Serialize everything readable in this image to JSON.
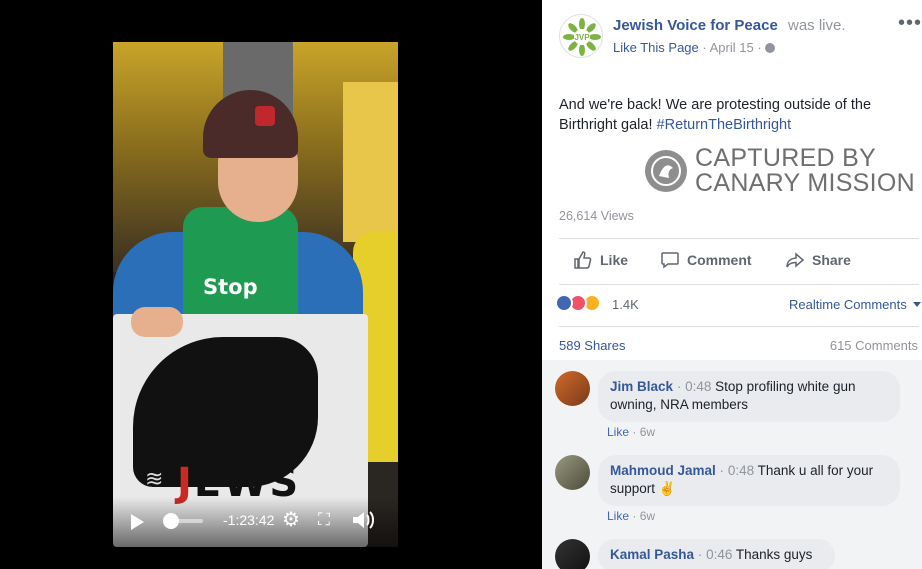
{
  "video": {
    "time_remaining": "-1:23:42",
    "shirt_text": "Stop",
    "sign_text": "JEWS"
  },
  "post": {
    "page_name": "Jewish Voice for Peace",
    "status": "was live.",
    "like_page": "Like This Page",
    "dot": "·",
    "date": "April 15",
    "logo_text": "JVP",
    "text": "And we're back! We are protesting outside of the Birthright gala!",
    "hashtag": "#ReturnTheBirthright",
    "watermark_line1": "CAPTURED BY",
    "watermark_line2": "CANARY MISSION",
    "views": "26,614 Views"
  },
  "actions": {
    "like": "Like",
    "comment": "Comment",
    "share": "Share"
  },
  "reactions": {
    "count": "1.4K",
    "realtime_label": "Realtime Comments",
    "shares": "589 Shares",
    "comments": "615 Comments"
  },
  "comments": [
    {
      "name": "Jim Black",
      "time": "0:48",
      "text": "Stop profiling white gun owning, NRA members",
      "like": "Like",
      "dot": "·",
      "age": "6w"
    },
    {
      "name": "Mahmoud Jamal",
      "time": "0:48",
      "text": "Thank u all for your support",
      "emoji": "✌",
      "like": "Like",
      "dot": "·",
      "age": "6w"
    },
    {
      "name": "Kamal Pasha",
      "time": "0:46",
      "text": "Thanks guys"
    }
  ],
  "colors": {
    "link": "#365899",
    "like_blue": "#4267b2",
    "love_red": "#f25268",
    "wow_yellow": "#f7b125"
  }
}
